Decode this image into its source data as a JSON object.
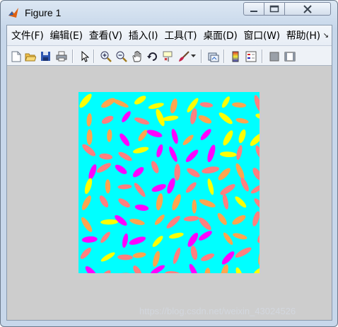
{
  "window": {
    "title": "Figure 1"
  },
  "menu": {
    "items": [
      "文件(F)",
      "编辑(E)",
      "查看(V)",
      "插入(I)",
      "工具(T)",
      "桌面(D)",
      "窗口(W)",
      "帮助(H)"
    ],
    "more": "↘"
  },
  "toolbar": {
    "icons": [
      "new-figure-icon",
      "open-file-icon",
      "save-icon",
      "print-icon",
      "select-arrow-icon",
      "zoom-in-icon",
      "zoom-out-icon",
      "pan-hand-icon",
      "rotate-3d-icon",
      "data-cursor-icon",
      "brush-icon",
      "brush-dropdown-icon",
      "link-plot-icon",
      "colorbar-icon",
      "legend-icon",
      "hide-plot-tools-icon",
      "show-plot-tools-icon"
    ]
  },
  "figure": {
    "background": "#00ffff",
    "palette": [
      "#ffff00",
      "#ff00ff",
      "#ffa54f",
      "#ff8080",
      "#ff7f7f"
    ]
  },
  "watermark": "https://blog.csdn.net/weixin_43024526"
}
